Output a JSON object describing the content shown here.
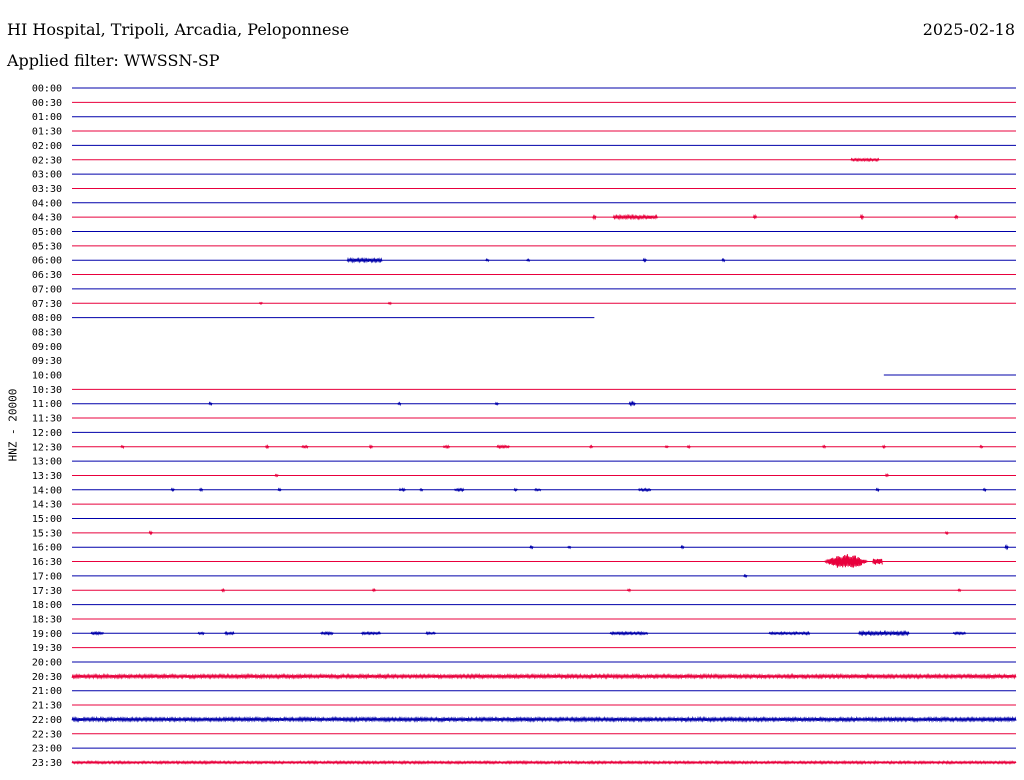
{
  "header": {
    "title": "HI Hospital, Tripoli, Arcadia, Peloponnese",
    "date": "2025-02-18",
    "filter": "Applied filter: WWSSN-SP"
  },
  "colors": {
    "even_trace": "#0000aa",
    "odd_trace": "#e8003c"
  },
  "chart_data": {
    "type": "line",
    "title": "",
    "ylabel": "HNZ - 20000",
    "xlabel": "",
    "grid": false,
    "row_minutes": 30,
    "x_range_min": [
      0,
      30
    ],
    "rows": [
      {
        "label": "00:00",
        "segments": [
          [
            0,
            30
          ]
        ],
        "events": []
      },
      {
        "label": "00:30",
        "segments": [
          [
            0,
            30
          ]
        ],
        "events": []
      },
      {
        "label": "01:00",
        "segments": [
          [
            0,
            30
          ]
        ],
        "events": []
      },
      {
        "label": "01:30",
        "segments": [
          [
            0,
            30
          ]
        ],
        "events": []
      },
      {
        "label": "02:00",
        "segments": [
          [
            0,
            30
          ]
        ],
        "events": []
      },
      {
        "label": "02:30",
        "segments": [
          [
            0,
            30
          ]
        ],
        "events": [
          {
            "t": 25.2,
            "w": 0.9,
            "a": 1
          }
        ]
      },
      {
        "label": "03:00",
        "segments": [
          [
            0,
            30
          ]
        ],
        "events": []
      },
      {
        "label": "03:30",
        "segments": [
          [
            0,
            30
          ]
        ],
        "events": []
      },
      {
        "label": "04:00",
        "segments": [
          [
            0,
            30
          ]
        ],
        "events": []
      },
      {
        "label": "04:30",
        "segments": [
          [
            0,
            30
          ]
        ],
        "events": [
          {
            "t": 17.9,
            "w": 1.4,
            "a": 1.5
          },
          {
            "t": 16.6,
            "w": 0.1,
            "a": 1.5
          },
          {
            "t": 21.7,
            "w": 0.1,
            "a": 1.5
          },
          {
            "t": 25.1,
            "w": 0.1,
            "a": 1.5
          },
          {
            "t": 28.1,
            "w": 0.1,
            "a": 1.5
          }
        ]
      },
      {
        "label": "05:00",
        "segments": [
          [
            0,
            30
          ]
        ],
        "events": []
      },
      {
        "label": "05:30",
        "segments": [
          [
            0,
            30
          ]
        ],
        "events": []
      },
      {
        "label": "06:00",
        "segments": [
          [
            0,
            30
          ]
        ],
        "events": [
          {
            "t": 9.3,
            "w": 1.1,
            "a": 1.5
          },
          {
            "t": 13.2,
            "w": 0.1,
            "a": 1
          },
          {
            "t": 14.5,
            "w": 0.1,
            "a": 1
          },
          {
            "t": 18.2,
            "w": 0.1,
            "a": 1
          },
          {
            "t": 20.7,
            "w": 0.1,
            "a": 1
          }
        ]
      },
      {
        "label": "06:30",
        "segments": [
          [
            0,
            30
          ]
        ],
        "events": []
      },
      {
        "label": "07:00",
        "segments": [
          [
            0,
            30
          ]
        ],
        "events": []
      },
      {
        "label": "07:30",
        "segments": [
          [
            0,
            30
          ]
        ],
        "events": [
          {
            "t": 6.0,
            "w": 0.1,
            "a": 1
          },
          {
            "t": 10.1,
            "w": 0.1,
            "a": 1
          }
        ]
      },
      {
        "label": "08:00",
        "segments": [
          [
            0,
            16.6
          ]
        ],
        "events": []
      },
      {
        "label": "08:30",
        "segments": [],
        "events": []
      },
      {
        "label": "09:00",
        "segments": [],
        "events": []
      },
      {
        "label": "09:30",
        "segments": [],
        "events": []
      },
      {
        "label": "10:00",
        "segments": [
          [
            25.8,
            30
          ]
        ],
        "events": []
      },
      {
        "label": "10:30",
        "segments": [
          [
            0,
            30
          ]
        ],
        "events": []
      },
      {
        "label": "11:00",
        "segments": [
          [
            0,
            30
          ]
        ],
        "events": [
          {
            "t": 4.4,
            "w": 0.1,
            "a": 1
          },
          {
            "t": 10.4,
            "w": 0.1,
            "a": 1
          },
          {
            "t": 13.5,
            "w": 0.1,
            "a": 1
          },
          {
            "t": 17.8,
            "w": 0.2,
            "a": 1.5
          }
        ]
      },
      {
        "label": "11:30",
        "segments": [
          [
            0,
            30
          ]
        ],
        "events": []
      },
      {
        "label": "12:00",
        "segments": [
          [
            0,
            30
          ]
        ],
        "events": []
      },
      {
        "label": "12:30",
        "segments": [
          [
            0,
            30
          ]
        ],
        "events": [
          {
            "t": 1.6,
            "w": 0.1,
            "a": 1
          },
          {
            "t": 6.2,
            "w": 0.1,
            "a": 1
          },
          {
            "t": 7.4,
            "w": 0.2,
            "a": 1
          },
          {
            "t": 9.5,
            "w": 0.1,
            "a": 1
          },
          {
            "t": 11.9,
            "w": 0.2,
            "a": 1
          },
          {
            "t": 13.7,
            "w": 0.4,
            "a": 1
          },
          {
            "t": 16.5,
            "w": 0.1,
            "a": 1
          },
          {
            "t": 18.9,
            "w": 0.1,
            "a": 1
          },
          {
            "t": 19.6,
            "w": 0.1,
            "a": 1
          },
          {
            "t": 23.9,
            "w": 0.1,
            "a": 1
          },
          {
            "t": 25.8,
            "w": 0.1,
            "a": 1
          },
          {
            "t": 28.9,
            "w": 0.1,
            "a": 1
          }
        ]
      },
      {
        "label": "13:00",
        "segments": [
          [
            0,
            30
          ]
        ],
        "events": []
      },
      {
        "label": "13:30",
        "segments": [
          [
            0,
            30
          ]
        ],
        "events": [
          {
            "t": 6.5,
            "w": 0.1,
            "a": 1
          },
          {
            "t": 25.9,
            "w": 0.1,
            "a": 1
          }
        ]
      },
      {
        "label": "14:00",
        "segments": [
          [
            0,
            30
          ]
        ],
        "events": [
          {
            "t": 3.2,
            "w": 0.1,
            "a": 1
          },
          {
            "t": 4.1,
            "w": 0.1,
            "a": 1
          },
          {
            "t": 6.6,
            "w": 0.1,
            "a": 1
          },
          {
            "t": 10.5,
            "w": 0.2,
            "a": 1
          },
          {
            "t": 11.1,
            "w": 0.1,
            "a": 1
          },
          {
            "t": 12.3,
            "w": 0.3,
            "a": 1
          },
          {
            "t": 14.1,
            "w": 0.1,
            "a": 1
          },
          {
            "t": 14.8,
            "w": 0.2,
            "a": 1
          },
          {
            "t": 18.2,
            "w": 0.4,
            "a": 1
          },
          {
            "t": 25.6,
            "w": 0.1,
            "a": 1
          },
          {
            "t": 29.0,
            "w": 0.1,
            "a": 1
          }
        ]
      },
      {
        "label": "14:30",
        "segments": [
          [
            0,
            30
          ]
        ],
        "events": []
      },
      {
        "label": "15:00",
        "segments": [
          [
            0,
            30
          ]
        ],
        "events": []
      },
      {
        "label": "15:30",
        "segments": [
          [
            0,
            30
          ]
        ],
        "events": [
          {
            "t": 2.5,
            "w": 0.1,
            "a": 1
          },
          {
            "t": 27.8,
            "w": 0.1,
            "a": 1
          }
        ]
      },
      {
        "label": "16:00",
        "segments": [
          [
            0,
            30
          ]
        ],
        "events": [
          {
            "t": 14.6,
            "w": 0.1,
            "a": 1
          },
          {
            "t": 15.8,
            "w": 0.1,
            "a": 1
          },
          {
            "t": 19.4,
            "w": 0.1,
            "a": 1
          },
          {
            "t": 29.7,
            "w": 0.1,
            "a": 1.5
          }
        ]
      },
      {
        "label": "16:30",
        "segments": [
          [
            0,
            30
          ]
        ],
        "events": [
          {
            "t": 24.6,
            "w": 1.4,
            "a": 8
          },
          {
            "t": 25.6,
            "w": 0.3,
            "a": 3
          }
        ]
      },
      {
        "label": "17:00",
        "segments": [
          [
            0,
            30
          ]
        ],
        "events": [
          {
            "t": 21.4,
            "w": 0.1,
            "a": 1
          }
        ]
      },
      {
        "label": "17:30",
        "segments": [
          [
            0,
            30
          ]
        ],
        "events": [
          {
            "t": 4.8,
            "w": 0.1,
            "a": 1
          },
          {
            "t": 9.6,
            "w": 0.1,
            "a": 1
          },
          {
            "t": 17.7,
            "w": 0.1,
            "a": 1
          },
          {
            "t": 28.2,
            "w": 0.1,
            "a": 1
          }
        ]
      },
      {
        "label": "18:00",
        "segments": [
          [
            0,
            30
          ]
        ],
        "events": []
      },
      {
        "label": "18:30",
        "segments": [
          [
            0,
            30
          ]
        ],
        "events": []
      },
      {
        "label": "19:00",
        "segments": [
          [
            0,
            30
          ]
        ],
        "events": [
          {
            "t": 0.8,
            "w": 0.4,
            "a": 1
          },
          {
            "t": 4.1,
            "w": 0.2,
            "a": 1
          },
          {
            "t": 5.0,
            "w": 0.3,
            "a": 1
          },
          {
            "t": 8.1,
            "w": 0.4,
            "a": 1
          },
          {
            "t": 9.5,
            "w": 0.6,
            "a": 1
          },
          {
            "t": 11.4,
            "w": 0.3,
            "a": 1
          },
          {
            "t": 17.7,
            "w": 1.2,
            "a": 1
          },
          {
            "t": 22.8,
            "w": 1.3,
            "a": 1
          },
          {
            "t": 25.8,
            "w": 1.6,
            "a": 1.5
          },
          {
            "t": 28.2,
            "w": 0.4,
            "a": 1
          }
        ]
      },
      {
        "label": "19:30",
        "segments": [
          [
            0,
            30
          ]
        ],
        "events": []
      },
      {
        "label": "20:00",
        "segments": [
          [
            0,
            30
          ]
        ],
        "events": []
      },
      {
        "label": "20:30",
        "segments": [
          [
            0,
            30
          ]
        ],
        "events": [
          {
            "t": 15,
            "w": 30,
            "a": 1.5
          }
        ]
      },
      {
        "label": "21:00",
        "segments": [
          [
            0,
            30
          ]
        ],
        "events": []
      },
      {
        "label": "21:30",
        "segments": [
          [
            0,
            30
          ]
        ],
        "events": []
      },
      {
        "label": "22:00",
        "segments": [
          [
            0,
            30
          ]
        ],
        "events": [
          {
            "t": 15,
            "w": 30,
            "a": 1.5
          }
        ]
      },
      {
        "label": "22:30",
        "segments": [
          [
            0,
            30
          ]
        ],
        "events": []
      },
      {
        "label": "23:00",
        "segments": [
          [
            0,
            30
          ]
        ],
        "events": []
      },
      {
        "label": "23:30",
        "segments": [
          [
            0,
            30
          ]
        ],
        "events": [
          {
            "t": 15,
            "w": 30,
            "a": 1
          }
        ]
      }
    ]
  }
}
